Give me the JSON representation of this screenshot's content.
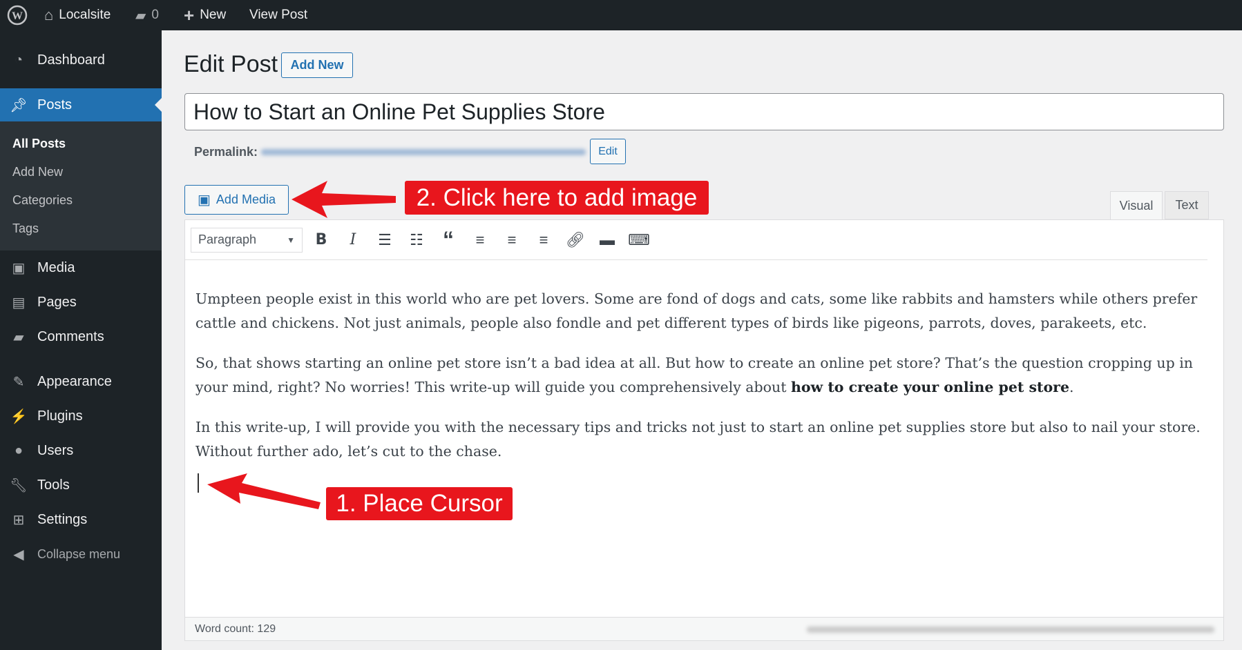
{
  "topbar": {
    "site": "Localsite",
    "comments": "0",
    "new": "New",
    "view": "View Post"
  },
  "sidebar": {
    "dashboard": "Dashboard",
    "posts": "Posts",
    "sub": [
      "All Posts",
      "Add New",
      "Categories",
      "Tags"
    ],
    "items": [
      "Media",
      "Pages",
      "Comments",
      "Appearance",
      "Plugins",
      "Users",
      "Tools",
      "Settings"
    ],
    "collapse": "Collapse menu"
  },
  "page": {
    "title": "Edit Post",
    "add_new": "Add New",
    "post_title": "How to Start an Online Pet Supplies Store",
    "permalink_label": "Permalink:",
    "permalink_edit": "Edit",
    "add_media": "Add Media",
    "tab_visual": "Visual",
    "tab_text": "Text",
    "format": "Paragraph",
    "word_count": "Word count: 129"
  },
  "content": {
    "p1": "Umpteen people exist in this world who are pet lovers. Some are fond of dogs and cats, some like rabbits and hamsters while others prefer cattle and chickens. Not just animals, people also fondle and pet different types of birds like pigeons, parrots, doves, parakeets, etc.",
    "p2a": "So, that shows starting an online pet store isn’t a bad idea at all. But how to create an online pet store? That’s the question cropping up in your mind, right? No worries! This write-up will guide you comprehensively about ",
    "p2b": "how to create your online pet store",
    "p2c": ".",
    "p3": "In this write-up, I will provide you with the necessary tips and tricks not just to start an online pet supplies store but also to nail your store. Without further ado, let’s cut to the chase."
  },
  "annotations": {
    "step2": "2. Click here to add image",
    "step1": "1. Place Cursor"
  },
  "colors": {
    "accent": "#2271b1",
    "annotation": "#e8161d",
    "admin_bar": "#1d2327"
  }
}
